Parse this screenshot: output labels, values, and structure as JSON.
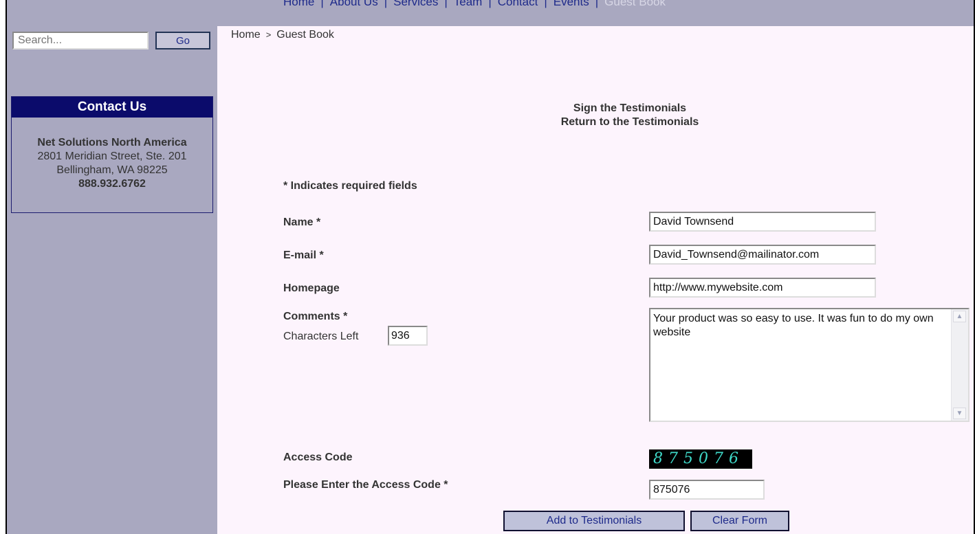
{
  "nav": {
    "items": [
      {
        "label": "Home"
      },
      {
        "label": "About Us"
      },
      {
        "label": "Services"
      },
      {
        "label": "Team"
      },
      {
        "label": "Contact"
      },
      {
        "label": "Events"
      },
      {
        "label": "Guest Book",
        "active": true
      }
    ]
  },
  "search": {
    "placeholder": "Search...",
    "button_label": "Go"
  },
  "contact": {
    "heading": "Contact Us",
    "company": "Net Solutions North America",
    "address_line1": "2801 Meridian Street, Ste. 201",
    "address_line2": "Bellingham, WA 98225",
    "phone": "888.932.6762"
  },
  "breadcrumb": {
    "home": "Home",
    "separator": ">",
    "current": "Guest Book"
  },
  "links": {
    "sign": "Sign the Testimonials",
    "return": "Return to the Testimonials"
  },
  "form": {
    "required_note": "* Indicates required fields",
    "name_label": "Name *",
    "name_value": "David Townsend",
    "email_label": "E-mail *",
    "email_value": "David_Townsend@mailinator.com",
    "homepage_label": "Homepage",
    "homepage_value": "http://www.mywebsite.com",
    "comments_label": "Comments *",
    "chars_left_label": "Characters Left",
    "chars_left_value": "936",
    "comments_value": "Your product was so easy to use. It was fun to do my own website",
    "access_code_label": "Access Code",
    "access_code_image_text": "875076",
    "enter_code_label": "Please Enter the Access Code *",
    "enter_code_value": "875076",
    "submit_label": "Add to Testimonials",
    "clear_label": "Clear Form"
  },
  "colors": {
    "sidebar_bg": "#a9a8c0",
    "main_bg": "#fdf4fd",
    "contact_head_bg": "#0b0b6b",
    "nav_link": "#1e2a8a",
    "captcha_text": "#3fd9c9"
  }
}
